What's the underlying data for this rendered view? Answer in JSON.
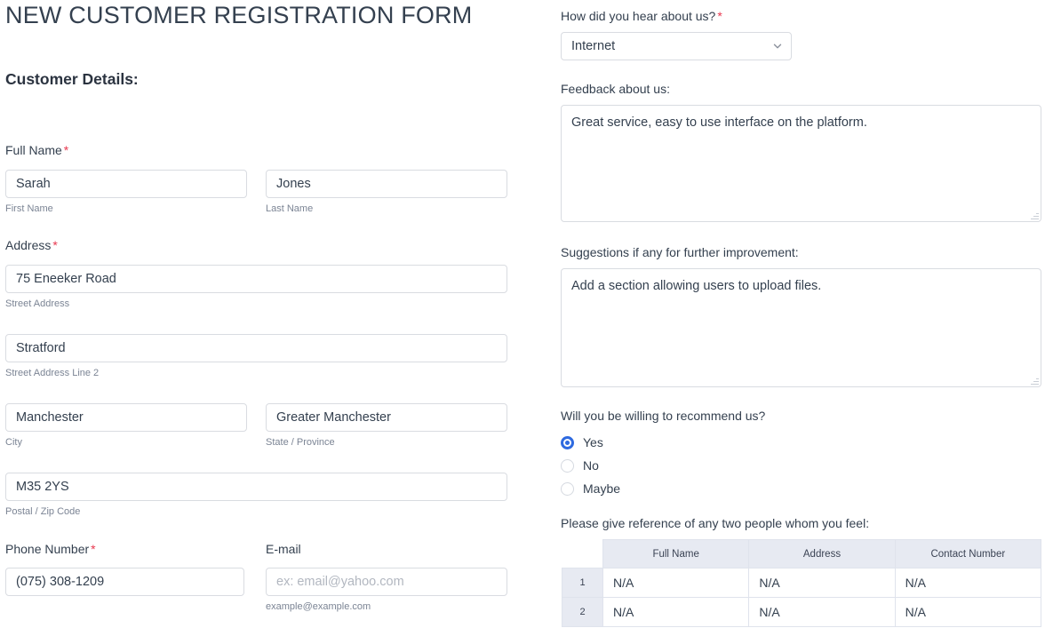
{
  "form": {
    "title": "NEW CUSTOMER REGISTRATION FORM",
    "section_heading": "Customer Details:"
  },
  "left": {
    "full_name": {
      "label": "Full Name",
      "required_mark": "*",
      "first": {
        "value": "Sarah",
        "sub": "First Name"
      },
      "last": {
        "value": "Jones",
        "sub": "Last Name"
      }
    },
    "address": {
      "label": "Address",
      "required_mark": "*",
      "street": {
        "value": "75 Eneeker Road",
        "sub": "Street Address"
      },
      "street2": {
        "value": "Stratford",
        "sub": "Street Address Line 2"
      },
      "city": {
        "value": "Manchester",
        "sub": "City"
      },
      "state": {
        "value": "Greater Manchester",
        "sub": "State / Province"
      },
      "postal": {
        "value": "M35 2YS",
        "sub": "Postal / Zip Code"
      }
    },
    "phone": {
      "label": "Phone Number",
      "required_mark": "*",
      "value": "(075) 308-1209"
    },
    "email": {
      "label": "E-mail",
      "value": "",
      "placeholder": "ex: email@yahoo.com",
      "sub": "example@example.com"
    }
  },
  "right": {
    "hear_about": {
      "label": "How did you hear about us?",
      "required_mark": "*",
      "selected": "Internet",
      "icon": "chevron-down-icon"
    },
    "feedback": {
      "label": "Feedback about us:",
      "value": "Great service, easy to use interface on the platform."
    },
    "suggestions": {
      "label": "Suggestions if any for further improvement:",
      "value": "Add a section allowing users to upload files."
    },
    "recommend": {
      "label": "Will you be willing to recommend us?",
      "options": [
        {
          "label": "Yes",
          "selected": true
        },
        {
          "label": "No",
          "selected": false
        },
        {
          "label": "Maybe",
          "selected": false
        }
      ]
    },
    "references": {
      "label": "Please give reference of any two people whom you feel:",
      "columns": [
        "Full Name",
        "Address",
        "Contact Number"
      ],
      "rows": [
        {
          "num": "1",
          "cells": [
            "N/A",
            "N/A",
            "N/A"
          ]
        },
        {
          "num": "2",
          "cells": [
            "N/A",
            "N/A",
            "N/A"
          ]
        }
      ]
    }
  },
  "colors": {
    "accent": "#2f6ae0",
    "required": "#e8384f",
    "text": "#34404f",
    "muted": "#7b8494",
    "border": "#d9dce1",
    "table_header_bg": "#e7eaf2"
  }
}
